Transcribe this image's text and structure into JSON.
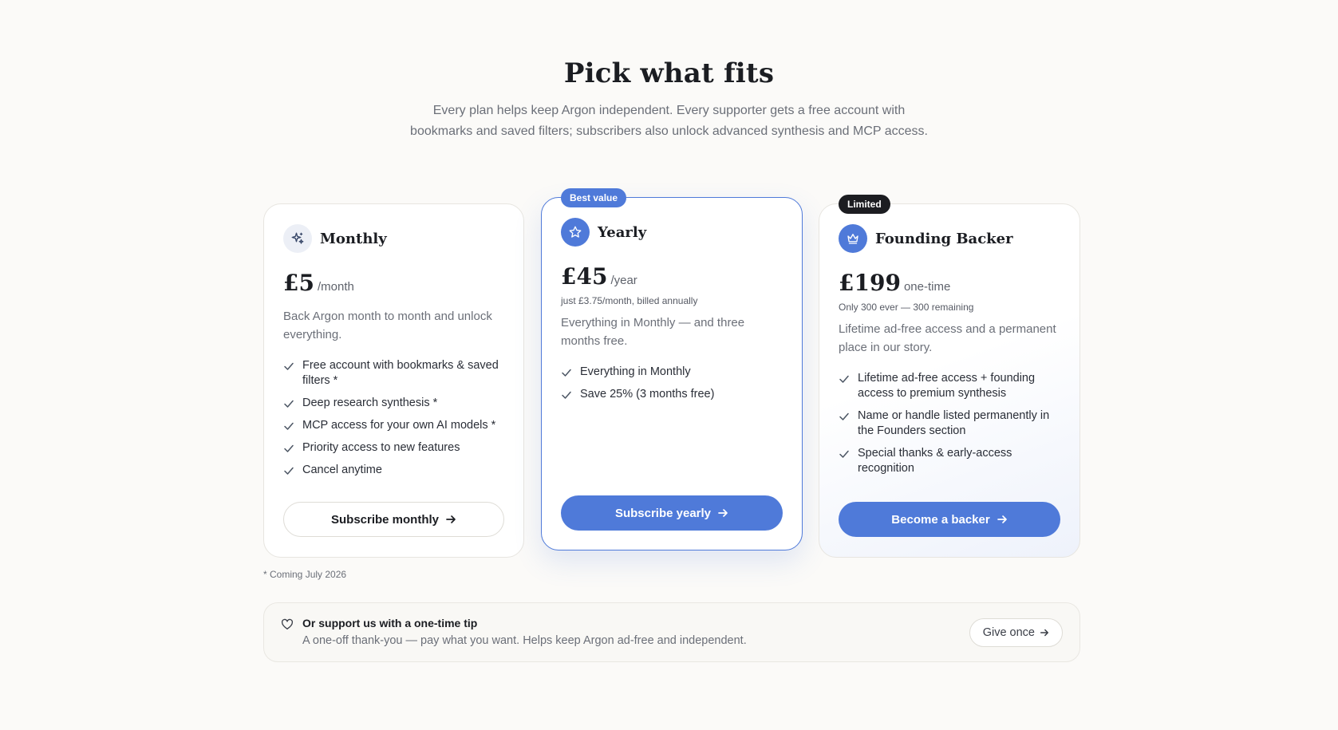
{
  "hero": {
    "title": "Pick what fits",
    "subtitle": "Every plan helps keep Argon independent. Every supporter gets a free account with bookmarks and saved filters; subscribers also unlock advanced synthesis and MCP access."
  },
  "colors": {
    "accent": "#4f7ad9",
    "dark_badge": "#1c1d21"
  },
  "plans": [
    {
      "name": "Monthly",
      "icon": "sparkles-icon",
      "price": "£5",
      "period": "/month",
      "description": "Back Argon month to month and unlock everything.",
      "features": [
        "Free account with bookmarks & saved filters *",
        "Deep research synthesis *",
        "MCP access for your own AI models *",
        "Priority access to new features",
        "Cancel anytime"
      ],
      "button": "Subscribe monthly"
    },
    {
      "name": "Yearly",
      "badge": "Best value",
      "icon": "star-icon",
      "price": "£45",
      "period": "/year",
      "price_note": "just £3.75/month, billed annually",
      "description": "Everything in Monthly — and three months free.",
      "features": [
        "Everything in Monthly",
        "Save 25% (3 months free)"
      ],
      "button": "Subscribe yearly"
    },
    {
      "name": "Founding Backer",
      "badge": "Limited",
      "icon": "crown-icon",
      "price": "£199",
      "period": "one-time",
      "price_note": "Only 300 ever — 300 remaining",
      "description": "Lifetime ad-free access and a permanent place in our story.",
      "features": [
        "Lifetime ad-free access + founding access to premium synthesis",
        "Name or handle listed permanently in the Founders section",
        "Special thanks & early-access recognition"
      ],
      "button": "Become a backer"
    }
  ],
  "footnote": "* Coming July 2026",
  "tip": {
    "title": "Or support us with a one-time tip",
    "description": "A one-off thank-you — pay what you want. Helps keep Argon ad-free and independent.",
    "button": "Give once"
  }
}
